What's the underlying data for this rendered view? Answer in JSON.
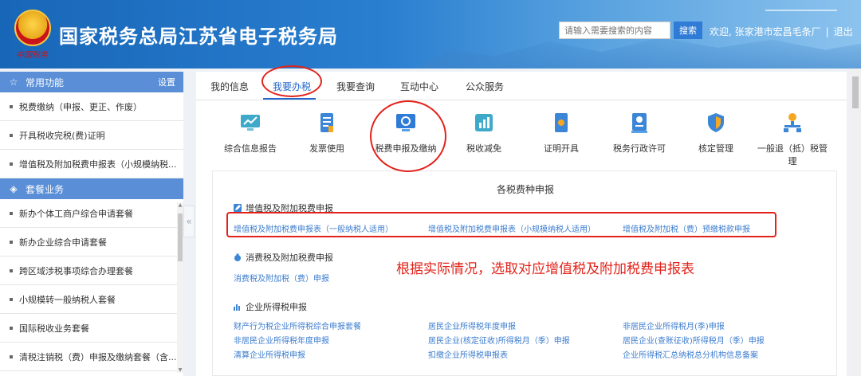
{
  "header": {
    "emblem_text": "中国税务",
    "title": "国家税务总局江苏省电子税务局",
    "search_placeholder": "请输入需要搜索的内容",
    "search_button": "搜索",
    "welcome": "欢迎, 张家港市宏昌毛条厂",
    "separator": "|",
    "logout": "退出"
  },
  "sidebar": {
    "common": {
      "title": "常用功能",
      "setting": "设置",
      "items": [
        "税费缴纳（申报、更正、作废）",
        "开具税收完税(费)证明",
        "增值税及附加税费申报表（小规模纳税..."
      ]
    },
    "package": {
      "title": "套餐业务",
      "items": [
        "新办个体工商户综合申请套餐",
        "新办企业综合申请套餐",
        "跨区域涉税事项综合办理套餐",
        "小规模转一般纳税人套餐",
        "国际税收业务套餐",
        "清税注销税（费）申报及缴纳套餐（含..."
      ]
    },
    "collapse_glyph": "«"
  },
  "tabs": [
    "我的信息",
    "我要办税",
    "我要查询",
    "互动中心",
    "公众服务"
  ],
  "active_tab": 1,
  "services": [
    "综合信息报告",
    "发票使用",
    "税费申报及缴纳",
    "税收减免",
    "证明开具",
    "税务行政许可",
    "核定管理",
    "一般退（抵）税管理"
  ],
  "section": {
    "title": "各税费种申报",
    "categories": [
      {
        "name": "增值税及附加税费申报",
        "links": [
          "增值税及附加税费申报表（一般纳税人适用）",
          "增值税及附加税费申报表（小规模纳税人适用）",
          "增值税及附加税（费）预缴税款申报"
        ]
      },
      {
        "name": "消费税及附加税费申报",
        "links": [
          "消费税及附加税（费）申报"
        ]
      },
      {
        "name": "企业所得税申报",
        "links": [
          "财产行为税企业所得税综合申报套餐",
          "居民企业所得税年度申报",
          "非居民企业所得税月(季)申报",
          "非居民企业所得税年度申报",
          "居民企业(核定征收)所得税月（季）申报",
          "居民企业(查账征收)所得税月（季）申报",
          "清算企业所得税申报",
          "扣缴企业所得税申报表",
          "企业所得税汇总纳税总分机构信息备案"
        ]
      }
    ],
    "annotation": "根据实际情况，选取对应增值税及附加税费申报表"
  },
  "colors": {
    "brand_blue": "#1866b8",
    "sidebar_head": "#5a8fd8",
    "link": "#3d7dcf",
    "annotation_red": "#e2231a",
    "active_tab": "#2266cc"
  }
}
